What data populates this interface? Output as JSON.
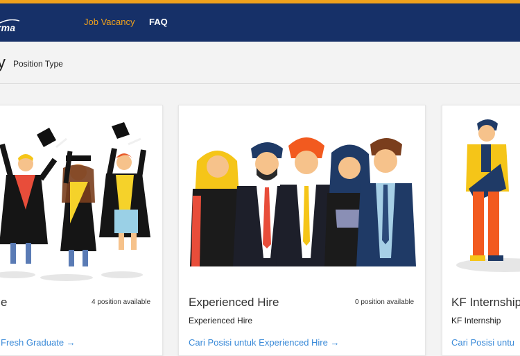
{
  "header": {
    "logo_text": "rma",
    "nav": [
      {
        "label": "Job Vacancy"
      },
      {
        "label": "FAQ"
      }
    ],
    "colors": {
      "navy": "#163068",
      "accent": "#f0a11c"
    }
  },
  "subheader": {
    "title_fragment": "y",
    "filter_label": "Position Type"
  },
  "cards": [
    {
      "title": "e",
      "availability": "4 position available",
      "subtitle": "",
      "link": "Fresh Graduate"
    },
    {
      "title": "Experienced Hire",
      "availability": "0 position available",
      "subtitle": "Experienced Hire",
      "link": "Cari Posisi untuk Experienced Hire"
    },
    {
      "title": "KF Internship",
      "availability": "",
      "subtitle": "KF Internship",
      "link": "Cari Posisi untu"
    }
  ],
  "link_arrow": "→"
}
